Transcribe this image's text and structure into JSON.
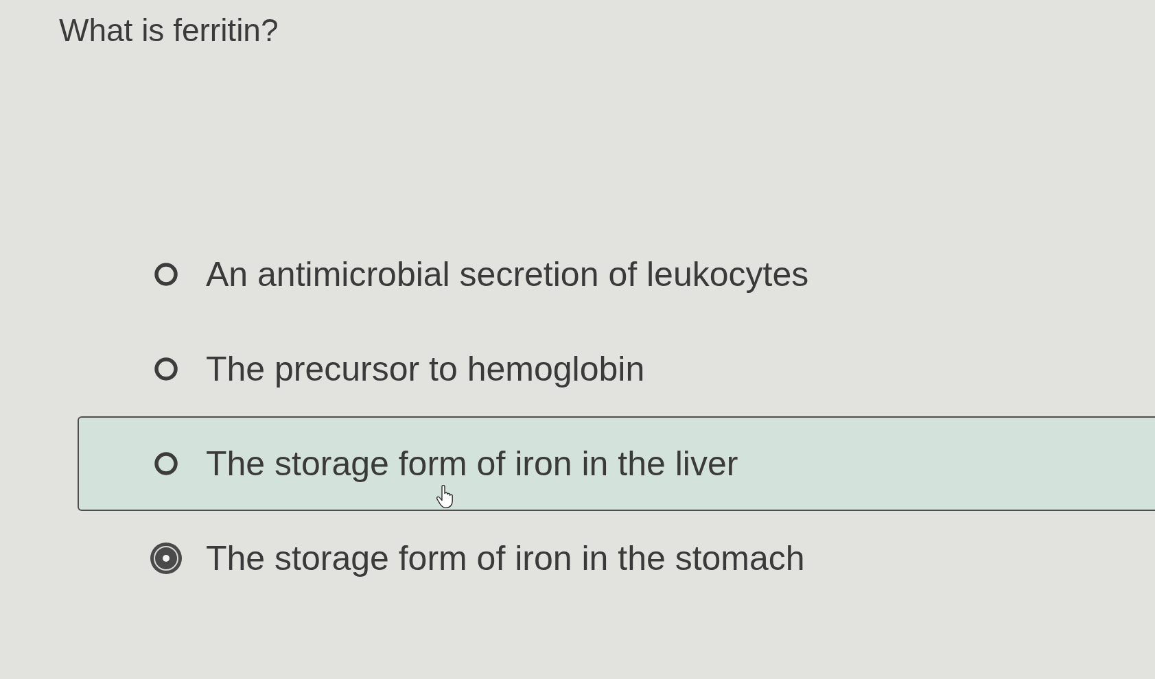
{
  "question": {
    "text": "What is ferritin?"
  },
  "options": [
    {
      "label": "An antimicrobial secretion of leukocytes",
      "selected": false,
      "hovered": false
    },
    {
      "label": "The precursor to hemoglobin",
      "selected": false,
      "hovered": false
    },
    {
      "label": "The storage form of iron in the liver",
      "selected": false,
      "hovered": true
    },
    {
      "label": "The storage form of iron in the stomach",
      "selected": true,
      "hovered": false
    }
  ]
}
